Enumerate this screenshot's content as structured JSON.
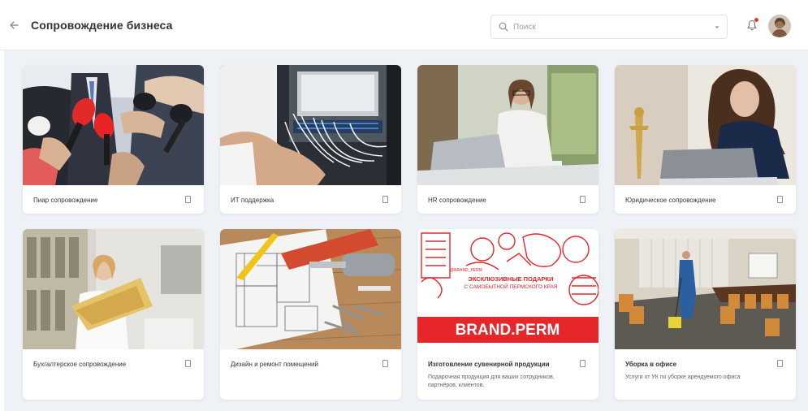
{
  "header": {
    "title": "Сопровождение бизнеса",
    "search_placeholder": "Поиск",
    "icons": [
      "back-arrow-icon",
      "search-icon",
      "chevron-down-icon",
      "bell-icon",
      "avatar"
    ],
    "notification_dot_color": "#e8343a"
  },
  "cards": [
    {
      "title": "Пиар сопровождение",
      "description": "",
      "image": "press-microphones"
    },
    {
      "title": "ИТ поддержка",
      "description": "",
      "image": "server-cables"
    },
    {
      "title": "HR сопровождение",
      "description": "",
      "image": "woman-laptop-office"
    },
    {
      "title": "Юридическое сопровождение",
      "description": "",
      "image": "woman-laptop-justice-statue"
    },
    {
      "title": "Бухгалтерское сопровождение",
      "description": "",
      "image": "woman-with-folders"
    },
    {
      "title": "Дизайн и ремонт помещений",
      "description": "",
      "image": "blueprints-tools"
    },
    {
      "title": "Изготовление сувенирной продукции",
      "description": "Подарочная продукция для ваших сотрудников, партнёров, клиентов.",
      "image": "brand-perm-poster",
      "poster": {
        "headline": "ЭКСКЛЮЗИВНЫЕ ПОДАРКИ",
        "subline": "С САМОБЫТНОЙ ПЕРМСКОГО КРАЯ",
        "brand": "BRAND.PERM",
        "handle": "@BRAND_PERM",
        "color": "#e5262b"
      }
    },
    {
      "title": "Уборка в офисе",
      "description": "Услуги от УК по уборке арендуемого офиса",
      "image": "office-cleaning"
    }
  ]
}
